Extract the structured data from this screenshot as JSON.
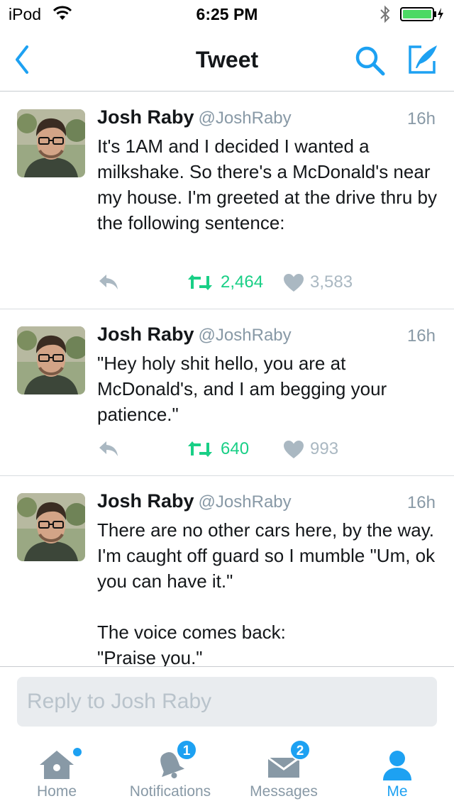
{
  "status_bar": {
    "carrier": "iPod",
    "time": "6:25 PM"
  },
  "nav": {
    "title": "Tweet",
    "icons": [
      "back-chevron-icon",
      "search-icon",
      "compose-icon"
    ]
  },
  "colors": {
    "accent": "#1da1f2",
    "retweet": "#19cf86",
    "muted": "#8899a6"
  },
  "tweets": [
    {
      "name": "Josh Raby",
      "handle": "@JoshRaby",
      "time": "16h",
      "text": "It's 1AM and I decided I wanted a milkshake. So there's a McDonald's near my house. I'm greeted at the drive thru by the following sentence:",
      "retweets": "2,464",
      "likes": "3,583"
    },
    {
      "name": "Josh Raby",
      "handle": "@JoshRaby",
      "time": "16h",
      "text": "\"Hey holy shit hello, you are at McDonald's, and I am begging your patience.\"",
      "retweets": "640",
      "likes": "993"
    },
    {
      "name": "Josh Raby",
      "handle": "@JoshRaby",
      "time": "16h",
      "text": "There are no other cars here, by the way.  I'm caught off guard so I mumble \"Um, ok you can have it.\"\n\nThe voice comes back:\n\"Praise you.\""
    }
  ],
  "reply": {
    "placeholder": "Reply to Josh Raby"
  },
  "tab_bar": {
    "items": [
      {
        "label": "Home",
        "icon": "home-icon"
      },
      {
        "label": "Notifications",
        "icon": "bell-icon",
        "badge": "1"
      },
      {
        "label": "Messages",
        "icon": "envelope-icon",
        "badge": "2"
      },
      {
        "label": "Me",
        "icon": "person-icon",
        "active": true
      }
    ]
  }
}
